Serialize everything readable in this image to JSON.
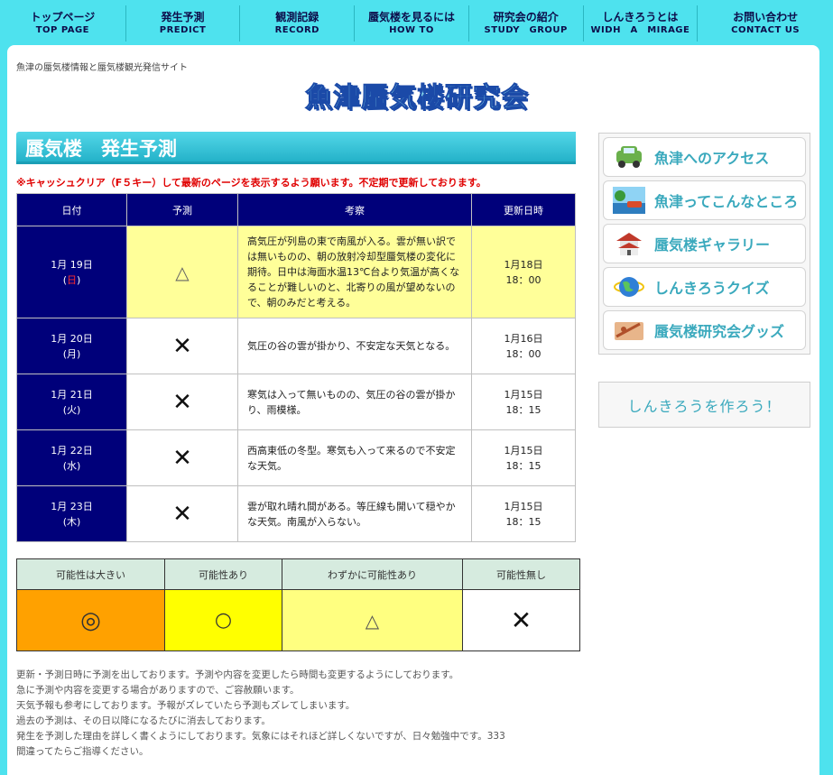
{
  "nav": [
    {
      "jp": "トップページ",
      "en": "TOP PAGE"
    },
    {
      "jp": "発生予測",
      "en": "PREDICT"
    },
    {
      "jp": "観測記録",
      "en": "RECORD"
    },
    {
      "jp": "蜃気楼を見るには",
      "en": "HOW TO"
    },
    {
      "jp": "研究会の紹介",
      "en": "STUDY　GROUP"
    },
    {
      "jp": "しんきろうとは",
      "en": "WIDH　A　MIRAGE"
    },
    {
      "jp": "お問い合わせ",
      "en": "CONTACT US"
    }
  ],
  "header": {
    "tagline": "魚津の蜃気楼情報と蜃気楼観光発信サイト",
    "logo": "魚津蜃気楼研究会"
  },
  "main": {
    "title": "蜃気楼　発生予測",
    "notice": "※キャッシュクリア（F５キー）して最新のページを表示するよう願います。不定期で更新しております。"
  },
  "forecast": {
    "headers": [
      "日付",
      "予測",
      "考察",
      "更新日時"
    ],
    "rows": [
      {
        "date": "1月 19日",
        "dow_open": "(",
        "dow": "日",
        "dow_close": ")",
        "mark": "△",
        "comment": "高気圧が列島の東で南風が入る。雲が無い訳では無いものの、朝の放射冷却型蜃気楼の変化に期待。日中は海面水温13℃台より気温が高くなることが難しいのと、北寄りの風が望めないので、朝のみだと考える。",
        "updated_date": "1月18日",
        "updated_time": "18：00"
      },
      {
        "date": "1月 20日",
        "dow_open": "(",
        "dow": "月",
        "dow_close": ")",
        "mark": "✕",
        "comment": "気圧の谷の雲が掛かり、不安定な天気となる。",
        "updated_date": "1月16日",
        "updated_time": "18：00"
      },
      {
        "date": "1月 21日",
        "dow_open": "(",
        "dow": "火",
        "dow_close": ")",
        "mark": "✕",
        "comment": "寒気は入って無いものの、気圧の谷の雲が掛かり、雨模様。",
        "updated_date": "1月15日",
        "updated_time": "18：15"
      },
      {
        "date": "1月 22日",
        "dow_open": "(",
        "dow": "水",
        "dow_close": ")",
        "mark": "✕",
        "comment": "西高東低の冬型。寒気も入って来るので不安定な天気。",
        "updated_date": "1月15日",
        "updated_time": "18：15"
      },
      {
        "date": "1月 23日",
        "dow_open": "(",
        "dow": "木",
        "dow_close": ")",
        "mark": "✕",
        "comment": "雲が取れ晴れ間がある。等圧線も開いて穏やかな天気。南風が入らない。",
        "updated_date": "1月15日",
        "updated_time": "18：15"
      }
    ]
  },
  "legend": {
    "headers": [
      "可能性は大きい",
      "可能性あり",
      "わずかに可能性あり",
      "可能性無し"
    ],
    "symbols": [
      "◎",
      "○",
      "△",
      "✕"
    ],
    "colors": [
      "#ffa100",
      "#ffff00",
      "#ffff80",
      "#ffffff"
    ]
  },
  "notes": [
    "更新・予測日時に予測を出しております。予測や内容を変更したら時間も変更するようにしております。",
    "急に予測や内容を変更する場合がありますので、ご容赦願います。",
    "天気予報も参考にしております。予報がズレていたら予測もズレてしまいます。",
    "過去の予測は、その日以降になるたびに消去しております。",
    "発生を予測した理由を詳しく書くようにしております。気象にはそれほど詳しくないですが、日々勉強中です。333",
    "間違ってたらご指導ください。"
  ],
  "sidebar": {
    "items": [
      {
        "label": "魚津へのアクセス",
        "icon": "car-icon"
      },
      {
        "label": "魚津ってこんなところ",
        "icon": "scenery-icon"
      },
      {
        "label": "蜃気楼ギャラリー",
        "icon": "castle-icon"
      },
      {
        "label": "しんきろうクイズ",
        "icon": "globe-icon"
      },
      {
        "label": "蜃気楼研究会グッズ",
        "icon": "goods-icon"
      }
    ],
    "make": "しんきろうを作ろう！"
  }
}
